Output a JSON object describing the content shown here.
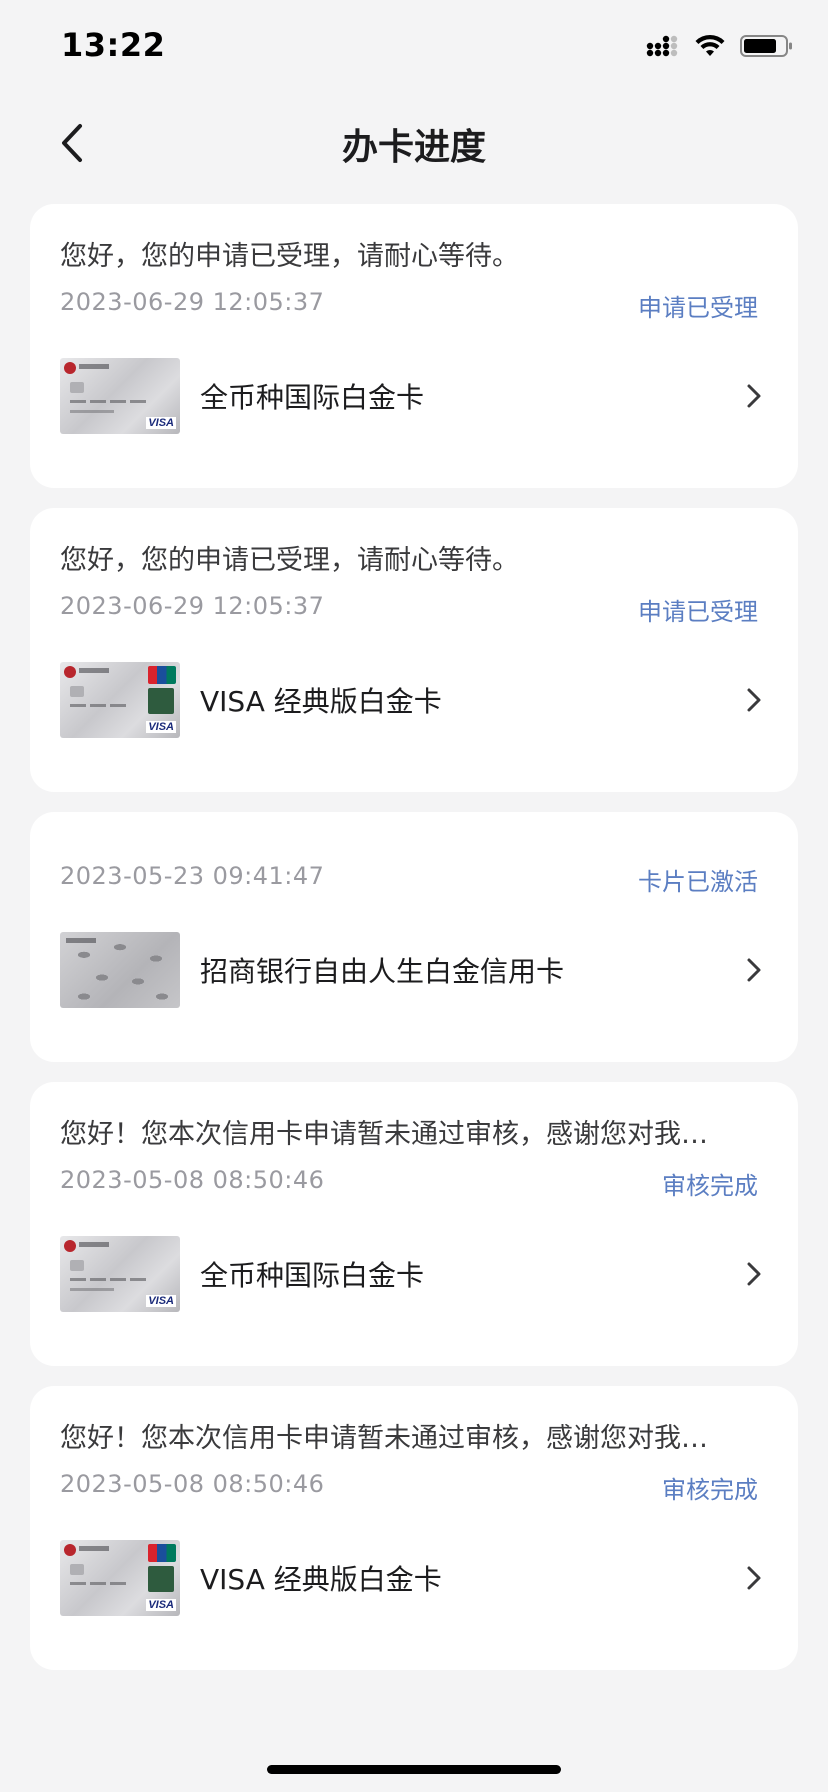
{
  "status_bar": {
    "time": "13:22"
  },
  "nav": {
    "title": "办卡进度"
  },
  "colors": {
    "background": "#f4f4f5",
    "card": "#ffffff",
    "status_text": "#5b7ec2",
    "date_text": "#9a9aa0"
  },
  "cards": [
    {
      "message": "您好，您的申请已受理，请耐心等待。",
      "date": "2023-06-29 12:05:37",
      "status": "申请已受理",
      "product": "全币种国际白金卡",
      "thumb": "visa-platinum-card-icon"
    },
    {
      "message": "您好，您的申请已受理，请耐心等待。",
      "date": "2023-06-29 12:05:37",
      "status": "申请已受理",
      "product": "VISA 经典版白金卡",
      "thumb": "visa-unionpay-card-icon"
    },
    {
      "message": "",
      "date": "2023-05-23 09:41:47",
      "status": "卡片已激活",
      "product": "招商银行自由人生白金信用卡",
      "thumb": "bird-pattern-card-icon"
    },
    {
      "message": "您好！您本次信用卡申请暂未通过审核，感谢您对我…",
      "date": "2023-05-08 08:50:46",
      "status": "审核完成",
      "product": "全币种国际白金卡",
      "thumb": "visa-platinum-card-icon"
    },
    {
      "message": "您好！您本次信用卡申请暂未通过审核，感谢您对我…",
      "date": "2023-05-08 08:50:46",
      "status": "审核完成",
      "product": "VISA 经典版白金卡",
      "thumb": "visa-unionpay-card-icon"
    }
  ]
}
